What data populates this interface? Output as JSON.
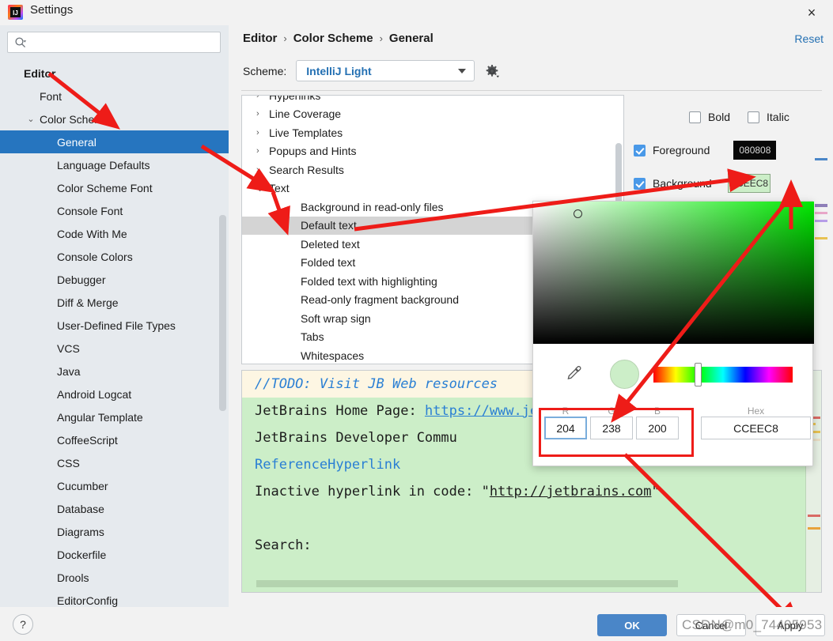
{
  "window": {
    "title": "Settings",
    "logo_text": "IJ",
    "close_icon": "×"
  },
  "sidebar": {
    "search": {
      "placeholder": "",
      "value": "",
      "icon": "search-icon"
    },
    "items": [
      {
        "label": "Editor",
        "level": 0,
        "twisty": "",
        "selected": false
      },
      {
        "label": "Font",
        "level": 1,
        "twisty": "",
        "selected": false
      },
      {
        "label": "Color Scheme",
        "level": 1,
        "twisty": "⌄",
        "selected": false
      },
      {
        "label": "General",
        "level": 2,
        "twisty": "",
        "selected": true
      },
      {
        "label": "Language Defaults",
        "level": 2,
        "twisty": "",
        "selected": false
      },
      {
        "label": "Color Scheme Font",
        "level": 2,
        "twisty": "",
        "selected": false
      },
      {
        "label": "Console Font",
        "level": 2,
        "twisty": "",
        "selected": false
      },
      {
        "label": "Code With Me",
        "level": 2,
        "twisty": "",
        "selected": false
      },
      {
        "label": "Console Colors",
        "level": 2,
        "twisty": "",
        "selected": false
      },
      {
        "label": "Debugger",
        "level": 2,
        "twisty": "",
        "selected": false
      },
      {
        "label": "Diff & Merge",
        "level": 2,
        "twisty": "",
        "selected": false
      },
      {
        "label": "User-Defined File Types",
        "level": 2,
        "twisty": "",
        "selected": false
      },
      {
        "label": "VCS",
        "level": 2,
        "twisty": "",
        "selected": false
      },
      {
        "label": "Java",
        "level": 2,
        "twisty": "",
        "selected": false
      },
      {
        "label": "Android Logcat",
        "level": 2,
        "twisty": "",
        "selected": false
      },
      {
        "label": "Angular Template",
        "level": 2,
        "twisty": "",
        "selected": false
      },
      {
        "label": "CoffeeScript",
        "level": 2,
        "twisty": "",
        "selected": false
      },
      {
        "label": "CSS",
        "level": 2,
        "twisty": "",
        "selected": false
      },
      {
        "label": "Cucumber",
        "level": 2,
        "twisty": "",
        "selected": false
      },
      {
        "label": "Database",
        "level": 2,
        "twisty": "",
        "selected": false
      },
      {
        "label": "Diagrams",
        "level": 2,
        "twisty": "",
        "selected": false
      },
      {
        "label": "Dockerfile",
        "level": 2,
        "twisty": "",
        "selected": false
      },
      {
        "label": "Drools",
        "level": 2,
        "twisty": "",
        "selected": false
      },
      {
        "label": "EditorConfig",
        "level": 2,
        "twisty": "",
        "selected": false
      }
    ]
  },
  "content": {
    "breadcrumb": [
      "Editor",
      "Color Scheme",
      "General"
    ],
    "breadcrumb_separator": "›",
    "reset_label": "Reset",
    "scheme_label": "Scheme:",
    "scheme_value": "IntelliJ Light",
    "scheme_settings_icon": "gear-icon"
  },
  "attributes": {
    "rows": [
      {
        "label": "Hyperlinks",
        "level": 1,
        "twisty": "›",
        "selected": false,
        "clipped": true
      },
      {
        "label": "Line Coverage",
        "level": 1,
        "twisty": "›",
        "selected": false
      },
      {
        "label": "Live Templates",
        "level": 1,
        "twisty": "›",
        "selected": false
      },
      {
        "label": "Popups and Hints",
        "level": 1,
        "twisty": "›",
        "selected": false
      },
      {
        "label": "Search Results",
        "level": 1,
        "twisty": "›",
        "selected": false
      },
      {
        "label": "Text",
        "level": 1,
        "twisty": "⌄",
        "selected": false
      },
      {
        "label": "Background in read-only files",
        "level": 2,
        "twisty": "",
        "selected": false
      },
      {
        "label": "Default text",
        "level": 2,
        "twisty": "",
        "selected": true
      },
      {
        "label": "Deleted text",
        "level": 2,
        "twisty": "",
        "selected": false
      },
      {
        "label": "Folded text",
        "level": 2,
        "twisty": "",
        "selected": false
      },
      {
        "label": "Folded text with highlighting",
        "level": 2,
        "twisty": "",
        "selected": false
      },
      {
        "label": "Read-only fragment background",
        "level": 2,
        "twisty": "",
        "selected": false
      },
      {
        "label": "Soft wrap sign",
        "level": 2,
        "twisty": "",
        "selected": false
      },
      {
        "label": "Tabs",
        "level": 2,
        "twisty": "",
        "selected": false
      },
      {
        "label": "Whitespaces",
        "level": 2,
        "twisty": "",
        "selected": false
      }
    ]
  },
  "options": {
    "bold": {
      "label": "Bold",
      "checked": false
    },
    "italic": {
      "label": "Italic",
      "checked": false
    },
    "foreground": {
      "label": "Foreground",
      "checked": true,
      "value": "080808",
      "color": "#080808"
    },
    "background": {
      "label": "Background",
      "checked": true,
      "value": "CCEEC8",
      "color": "#CCEEC8"
    }
  },
  "preview": {
    "line_todo": "//TODO: Visit JB Web resources",
    "line_home_prefix": "JetBrains Home Page: ",
    "line_home_link": "https://www.jetbrains.com",
    "line_community_prefix": "JetBrains Developer Commu",
    "line_reference": "ReferenceHyperlink",
    "line_inactive_prefix": "Inactive hyperlink in code: \"",
    "line_inactive_url": "http://jetbrains.com",
    "line_inactive_suffix": "\"",
    "line_search": "Search:"
  },
  "color_picker": {
    "sv_handle_title": "saturation-value-handle",
    "eyedropper_icon": "eyedropper-icon",
    "preview_color": "#CCEEC8",
    "fields": [
      {
        "name": "R",
        "value": "204",
        "active": true
      },
      {
        "name": "G",
        "value": "238",
        "active": false
      },
      {
        "name": "B",
        "value": "200",
        "active": false
      }
    ],
    "hex": {
      "name": "Hex",
      "value": "CCEEC8"
    }
  },
  "footer": {
    "help_label": "?",
    "ok_label": "OK",
    "cancel_label": "Cancel",
    "apply_label": "Apply",
    "watermark": "CSDN@m0_74405953"
  },
  "annotations": {
    "accent_color": "#EE1C18"
  }
}
